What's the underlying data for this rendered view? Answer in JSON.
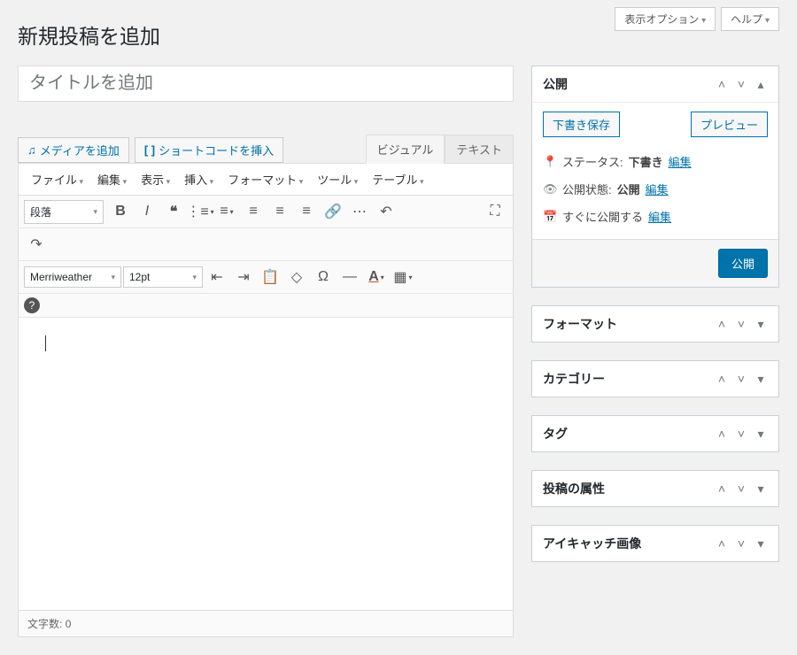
{
  "top": {
    "screen_options": "表示オプション",
    "help": "ヘルプ"
  },
  "page_title": "新規投稿を追加",
  "title_placeholder": "タイトルを追加",
  "media_button": "メディアを追加",
  "shortcode_button": "ショートコードを挿入",
  "tabs": {
    "visual": "ビジュアル",
    "text": "テキスト"
  },
  "menubar": [
    "ファイル",
    "編集",
    "表示",
    "挿入",
    "フォーマット",
    "ツール",
    "テーブル"
  ],
  "toolbar": {
    "format_select": "段落",
    "font_family": "Merriweather",
    "font_size": "12pt"
  },
  "status": {
    "wordcount_label": "文字数:",
    "wordcount": "0"
  },
  "publish": {
    "title": "公開",
    "save_draft": "下書き保存",
    "preview": "プレビュー",
    "status_label": "ステータス:",
    "status_value": "下書き",
    "visibility_label": "公開状態:",
    "visibility_value": "公開",
    "schedule_label": "すぐに公開する",
    "edit": "編集",
    "submit": "公開"
  },
  "boxes": {
    "format": "フォーマット",
    "category": "カテゴリー",
    "tags": "タグ",
    "attributes": "投稿の属性",
    "featured": "アイキャッチ画像"
  }
}
